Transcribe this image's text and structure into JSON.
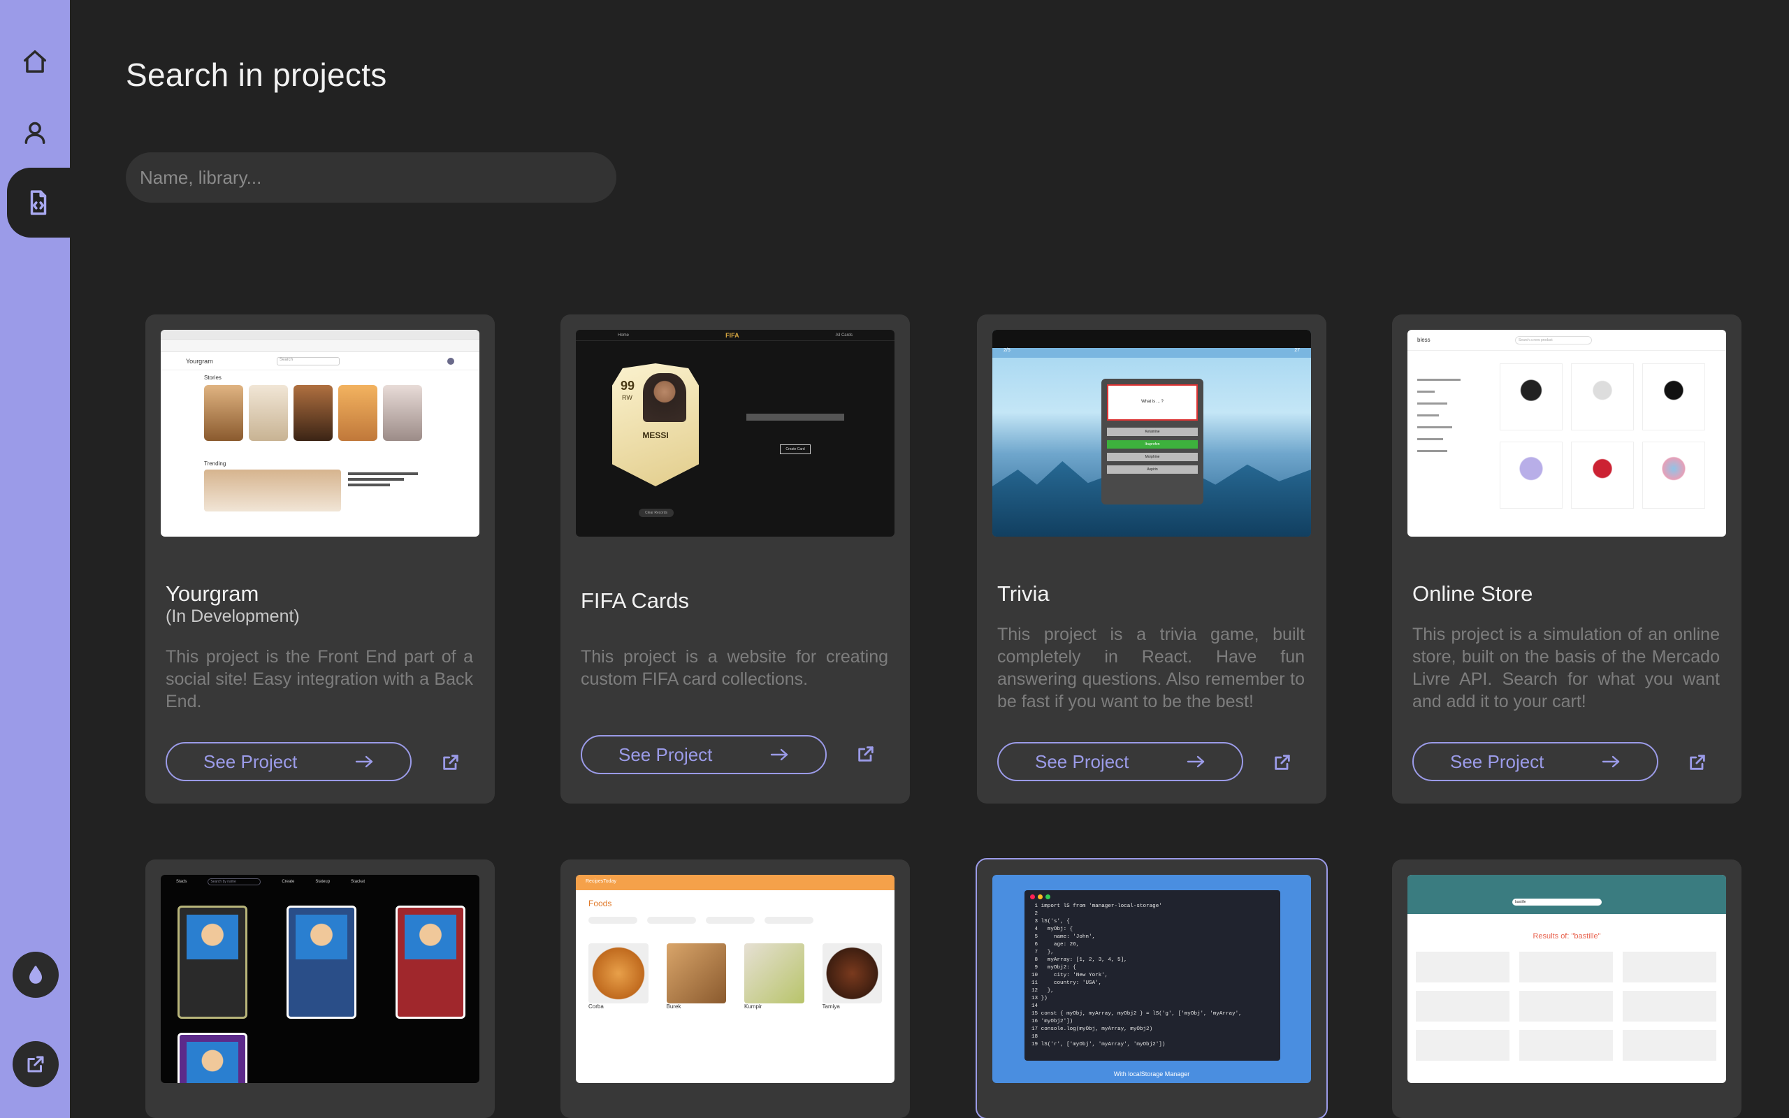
{
  "page": {
    "title": "Search in projects"
  },
  "search": {
    "placeholder": "Name, library..."
  },
  "sidebar": {
    "items": [
      {
        "name": "home",
        "icon": "home-icon"
      },
      {
        "name": "profile",
        "icon": "user-icon"
      },
      {
        "name": "projects",
        "icon": "code-file-icon",
        "active": true
      }
    ],
    "bottom": [
      {
        "name": "theme",
        "icon": "droplet-icon"
      },
      {
        "name": "external",
        "icon": "external-link-icon"
      }
    ]
  },
  "projects": [
    {
      "title": "Yourgram",
      "subtitle": "(In Development)",
      "description": "This project is the Front End part of a social site! Easy integration with a Back End.",
      "button": "See Project"
    },
    {
      "title": "FIFA Cards",
      "description": "This project is a website for creating custom FIFA card collections.",
      "button": "See Project"
    },
    {
      "title": "Trivia",
      "description": "This project is a trivia game, built completely in React. Have fun answering questions. Also remember to be fast if you want to be the best!",
      "button": "See Project"
    },
    {
      "title": "Online Store",
      "description": "This project is a simulation of an online store, built on the basis of the Mercado Livre API. Search for what you want and add it to your cart!",
      "button": "See Project"
    }
  ],
  "thumbs": {
    "yourgram": {
      "logo": "Yourgram",
      "stories": "Stories",
      "trending": "Trending",
      "search": "Search"
    },
    "fifa": {
      "logo": "FIFA",
      "nav_home": "Home",
      "nav_all": "All Cards",
      "player": "MESSI",
      "rating": "99",
      "position": "RW",
      "button": "Create Card",
      "clear": "Clear Records"
    },
    "trivia": {
      "score_left": "2/5",
      "score_right": "27",
      "question": "What is ... ?",
      "answers": [
        "Ketamine",
        "Ibuprofen",
        "Morphine",
        "Aspirin"
      ]
    },
    "store": {
      "logo": "bless",
      "search": "Search a new product"
    },
    "cards2": {
      "logo": "Stads",
      "search": "Search by name",
      "nav": [
        "Create",
        "Stateup",
        "Stackat"
      ]
    },
    "recipes": {
      "logo": "RecipesToday",
      "heading": "Foods",
      "labels": [
        "Corba",
        "Burek",
        "Kumpir",
        "Tamiya"
      ]
    },
    "storage": {
      "caption": "With localStorage Manager",
      "code": [
        "import lS from 'manager-local-storage'",
        "",
        "lS('s', {",
        "  myObj: {",
        "    name: 'John',",
        "    age: 26,",
        "  },",
        "  myArray: [1, 2, 3, 4, 5],",
        "  myObj2: {",
        "    city: 'New York',",
        "    country: 'USA',",
        "  },",
        "})",
        "",
        "const { myObj, myArray, myObj2 } = lS('g', ['myObj', 'myArray',",
        "'myObj2'])",
        "console.log(myObj, myArray, myObj2)",
        "",
        "lS('r', ['myObj', 'myArray', 'myObj2'])"
      ]
    },
    "music": {
      "results": "Results of: \"bastille\"",
      "query": "bastille"
    }
  },
  "colors": {
    "accent": "#9b9be8",
    "background": "#222222",
    "card": "#383838"
  }
}
